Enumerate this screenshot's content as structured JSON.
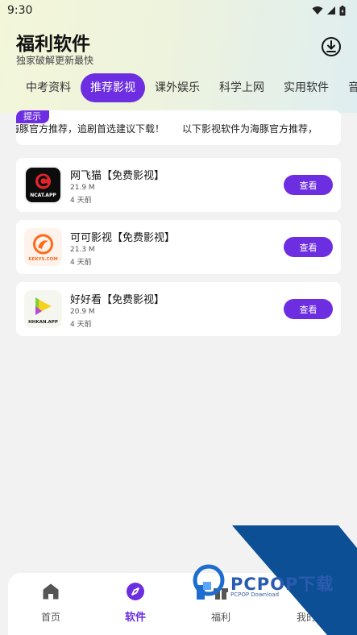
{
  "status": {
    "time": "9:30"
  },
  "header": {
    "title": "福利软件",
    "subtitle": "独家破解更新最快"
  },
  "tabs": [
    {
      "label": "中考资料",
      "active": false
    },
    {
      "label": "推荐影视",
      "active": true
    },
    {
      "label": "课外娱乐",
      "active": false
    },
    {
      "label": "科学上网",
      "active": false
    },
    {
      "label": "实用软件",
      "active": false
    },
    {
      "label": "音乐",
      "active": false
    }
  ],
  "notice": {
    "badge": "提示",
    "text_a": "海豚官方推荐，追剧首选建议下载！",
    "text_b": "以下影视软件为海豚官方推荐，"
  },
  "apps": [
    {
      "name": "网飞猫【免费影视】",
      "size": "21.9 M",
      "time": "4 天前",
      "button": "查看",
      "icon": "ncat-app-icon",
      "icon_text": "NCAT.APP"
    },
    {
      "name": "可可影视【免费影视】",
      "size": "21.3 M",
      "time": "4 天前",
      "button": "查看",
      "icon": "keys-app-icon",
      "icon_text": "KEKYS.COM"
    },
    {
      "name": "好好看【免费影视】",
      "size": "20.9 M",
      "time": "4 天前",
      "button": "查看",
      "icon": "hhkan-app-icon",
      "icon_text": "HHKAN.APP"
    }
  ],
  "nav": [
    {
      "label": "首页",
      "icon": "home-icon"
    },
    {
      "label": "软件",
      "icon": "compass-icon",
      "active": true
    },
    {
      "label": "福利",
      "icon": "gift-icon"
    },
    {
      "label": "我的",
      "icon": "user-icon"
    }
  ],
  "watermark": {
    "text": "PCPOP下载",
    "sub": "PCPOP Download"
  },
  "colors": {
    "accent": "#6c2ee0",
    "watermark": "#0c4f94"
  }
}
